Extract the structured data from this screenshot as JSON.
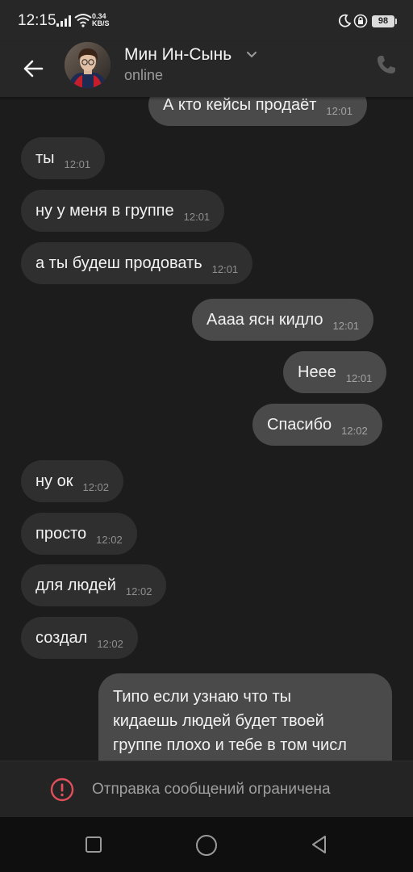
{
  "status_bar": {
    "time": "12:15",
    "speed_value": "0.34",
    "speed_unit": "KB/S",
    "battery": "98"
  },
  "header": {
    "name": "Мин Ин-Сынь",
    "status": "online"
  },
  "messages": [
    {
      "dir": "out",
      "text": "А кто кейсы продаёт",
      "time": "12:01"
    },
    {
      "dir": "in",
      "text": "ты",
      "time": "12:01"
    },
    {
      "dir": "in",
      "text": "ну у меня в группе",
      "time": "12:01"
    },
    {
      "dir": "in",
      "text": "а ты будеш продовать",
      "time": "12:01"
    },
    {
      "dir": "out",
      "text": "Аааа ясн кидло",
      "time": "12:01"
    },
    {
      "dir": "out",
      "text": "Неее",
      "time": "12:01"
    },
    {
      "dir": "out",
      "text": "Спасибо",
      "time": "12:02"
    },
    {
      "dir": "in",
      "text": "ну ок",
      "time": "12:02"
    },
    {
      "dir": "in",
      "text": "просто",
      "time": "12:02"
    },
    {
      "dir": "in",
      "text": "для людей",
      "time": "12:02"
    },
    {
      "dir": "in",
      "text": "создал",
      "time": "12:02"
    },
    {
      "dir": "out",
      "lines": [
        "Типо если узнаю что ты",
        "кидаешь людей будет твоей",
        "группе плохо и тебе в том числ"
      ]
    }
  ],
  "restriction": {
    "text": "Отправка сообщений ограничена"
  },
  "colors": {
    "background": "#1c1c1c",
    "header": "#272727",
    "incoming_bubble": "#2f2f2f",
    "outgoing_bubble": "#4a4a4a",
    "warning": "#e0505a"
  },
  "icons": {
    "back": "arrow-left",
    "chevron": "chevron-down",
    "call": "phone",
    "warning": "exclamation-circle",
    "nav_recent": "square",
    "nav_home": "circle",
    "nav_back": "triangle-left"
  }
}
